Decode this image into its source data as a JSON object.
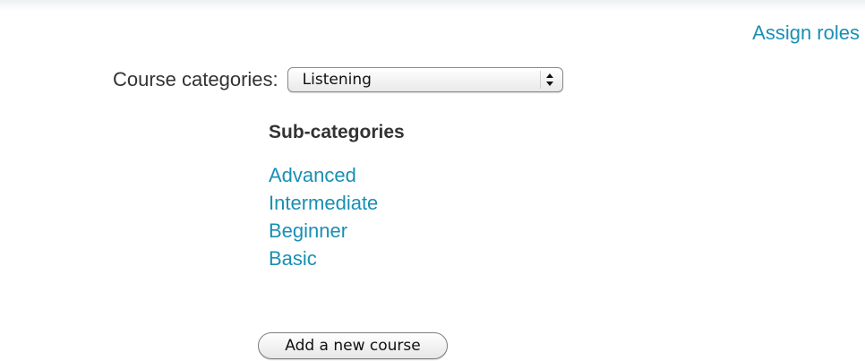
{
  "header": {
    "assign_roles_label": "Assign roles"
  },
  "course_categories": {
    "label": "Course categories:",
    "selected": "Listening"
  },
  "sub_categories": {
    "heading": "Sub-categories",
    "items": [
      {
        "label": "Advanced"
      },
      {
        "label": "Intermediate"
      },
      {
        "label": "Beginner"
      },
      {
        "label": "Basic"
      }
    ]
  },
  "actions": {
    "add_course_label": "Add a new course"
  },
  "colors": {
    "link": "#1a8fb3",
    "text": "#333333"
  }
}
